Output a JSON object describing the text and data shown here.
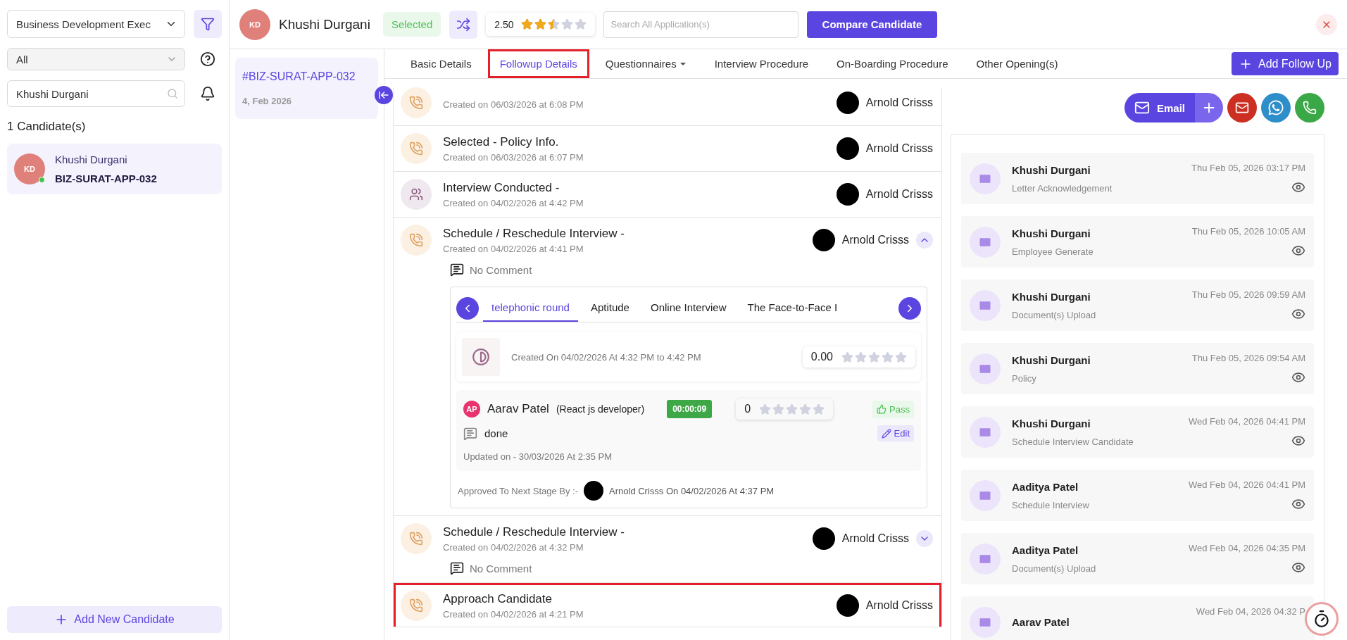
{
  "sidebar": {
    "position_select": {
      "value": "Business Development Exec"
    },
    "status_select": {
      "value": "All"
    },
    "search": {
      "value": "Khushi Durgani"
    },
    "count": "1 Candidate(s)",
    "candidates": [
      {
        "initials": "KD",
        "name": "Khushi Durgani",
        "code": "BIZ-SURAT-APP-032",
        "online": true,
        "selected": true
      }
    ],
    "add_button": "Add New Candidate"
  },
  "header": {
    "initials": "KD",
    "name": "Khushi Durgani",
    "status": "Selected",
    "rating": "2.50",
    "stars": 2.5,
    "search": {
      "placeholder": "Search All Application(s)"
    },
    "compare_button": "Compare Candidate"
  },
  "applications": [
    {
      "code": "#BIZ-SURAT-APP-032",
      "date": "4, Feb 2026",
      "selected": true
    }
  ],
  "tabs": [
    {
      "label": "Basic Details",
      "selected": false,
      "highlighted": false,
      "dropdown": false
    },
    {
      "label": "Followup Details",
      "selected": true,
      "highlighted": true,
      "dropdown": false
    },
    {
      "label": "Questionnaires",
      "selected": false,
      "highlighted": false,
      "dropdown": true
    },
    {
      "label": "Interview Procedure",
      "selected": false,
      "highlighted": false,
      "dropdown": false
    },
    {
      "label": "On-Boarding Procedure",
      "selected": false,
      "highlighted": false,
      "dropdown": false
    },
    {
      "label": "Other Opening(s)",
      "selected": false,
      "highlighted": false,
      "dropdown": false
    }
  ],
  "add_follow_up": "Add Follow Up",
  "actions": {
    "email": "Email"
  },
  "timeline": [
    {
      "kind": "call",
      "created": "Created on 06/03/2026 at 6:08 PM",
      "author": "Arnold Crisss",
      "highlighted": false
    },
    {
      "kind": "call",
      "title": "Selected - Policy Info.",
      "created": "Created on 06/03/2026 at 6:07 PM",
      "author": "Arnold Crisss",
      "highlighted": false
    },
    {
      "kind": "interview",
      "title": "Interview Conducted -",
      "created": "Created on 04/02/2026 at 4:42 PM",
      "author": "Arnold Crisss",
      "highlighted": false
    },
    {
      "kind": "call",
      "title": "Schedule / Reschedule Interview -",
      "created": "Created on 04/02/2026 at 4:41 PM",
      "author": "Arnold Crisss",
      "highlighted": false,
      "expanded": true,
      "comment": "No Comment",
      "details": {
        "rounds": [
          {
            "label": "telephonic round",
            "selected": true
          },
          {
            "label": "Aptitude",
            "selected": false
          },
          {
            "label": "Online Interview",
            "selected": false
          },
          {
            "label": "The Face-to-Face I",
            "selected": false
          }
        ],
        "session": {
          "created": "Created On 04/02/2026 At 4:32 PM to 4:42 PM",
          "rating": "0.00",
          "stars": 0
        },
        "interviewer": {
          "initials": "AP",
          "name": "Aarav Patel",
          "role": "(React js developer)",
          "duration": "00:00:09",
          "rating": "0",
          "stars": 0,
          "result": "Pass",
          "comment": "done",
          "edit": "Edit",
          "updated": "Updated on - 30/03/2026 At 2:35 PM"
        },
        "approved_label": "Approved To Next Stage By :-",
        "approved_by": "Arnold Crisss On 04/02/2026 At 4:37 PM"
      }
    },
    {
      "kind": "call",
      "title": "Schedule / Reschedule Interview -",
      "created": "Created on 04/02/2026 at 4:32 PM",
      "author": "Arnold Crisss",
      "highlighted": false,
      "expanded": false,
      "comment": "No Comment"
    },
    {
      "kind": "call",
      "title": "Approach Candidate",
      "created": "Created on 04/02/2026 at 4:21 PM",
      "author": "Arnold Crisss",
      "highlighted": true
    }
  ],
  "emails": [
    {
      "name": "Khushi Durgani",
      "subject": "Letter Acknowledgement",
      "date": "Thu Feb 05, 2026 03:17 PM"
    },
    {
      "name": "Khushi Durgani",
      "subject": "Employee Generate",
      "date": "Thu Feb 05, 2026 10:05 AM"
    },
    {
      "name": "Khushi Durgani",
      "subject": "Document(s) Upload",
      "date": "Thu Feb 05, 2026 09:59 AM"
    },
    {
      "name": "Khushi Durgani",
      "subject": "Policy",
      "date": "Thu Feb 05, 2026 09:54 AM"
    },
    {
      "name": "Khushi Durgani",
      "subject": "Schedule Interview Candidate",
      "date": "Wed Feb 04, 2026 04:41 PM"
    },
    {
      "name": "Aaditya Patel",
      "subject": "Schedule Interview",
      "date": "Wed Feb 04, 2026 04:41 PM"
    },
    {
      "name": "Aaditya Patel",
      "subject": "Document(s) Upload",
      "date": "Wed Feb 04, 2026 04:35 PM"
    },
    {
      "name": "Aarav Patel",
      "date": "Wed Feb 04, 2026 04:32 P"
    }
  ]
}
